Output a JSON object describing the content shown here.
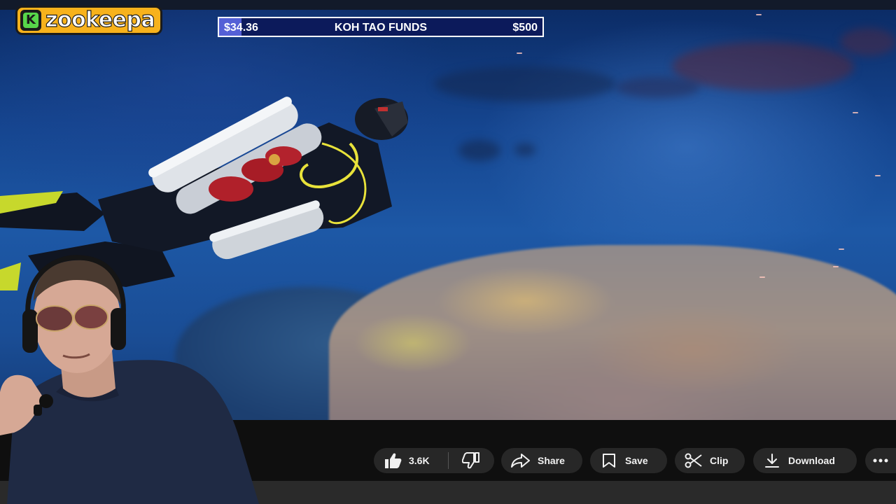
{
  "brand": {
    "logo_letter": "K",
    "logo_text": "zookeepa",
    "accent": "#f7b21c",
    "logo_green": "#57d64a"
  },
  "funds_bar": {
    "current": "$34.36",
    "title": "KOH TAO FUNDS",
    "target": "$500",
    "progress_fraction": 0.069,
    "bar_color": "#0c1a5b",
    "fill_color": "#5560d6"
  },
  "video": {
    "scene": "diver-over-reef",
    "water_color": "#1d58a6"
  },
  "actions": {
    "like_count": "3.6K",
    "share_label": "Share",
    "save_label": "Save",
    "clip_label": "Clip",
    "download_label": "Download",
    "icons": {
      "like": "thumbs-up-icon",
      "dislike": "thumbs-down-icon",
      "share": "share-arrow-icon",
      "save": "bookmark-icon",
      "clip": "scissors-icon",
      "download": "download-icon",
      "more": "more-horizontal-icon"
    }
  }
}
